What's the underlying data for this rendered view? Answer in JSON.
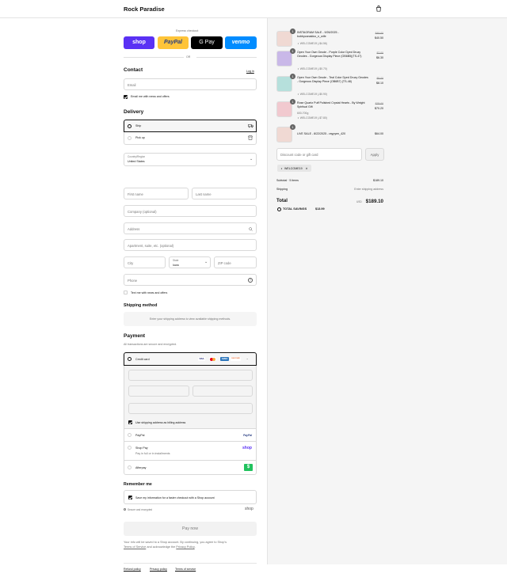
{
  "header": {
    "brand": "Rock Paradise",
    "bag_icon": "shopping-bag-icon"
  },
  "express": {
    "label": "Express checkout",
    "buttons": [
      {
        "label": "shop",
        "color": "#5a31f4"
      },
      {
        "label": "PayPal",
        "color": "#ffc439"
      },
      {
        "label": "G Pay",
        "color": "#000000"
      },
      {
        "label": "venmo",
        "color": "#008cff"
      }
    ],
    "or": "OR"
  },
  "contact": {
    "title": "Contact",
    "login": "Log in",
    "email_placeholder": "Email",
    "news_label": "Email me with news and offers",
    "news_checked": true
  },
  "delivery": {
    "title": "Delivery",
    "ship": "Ship",
    "pickup": "Pick up",
    "country_label": "Country/Region",
    "country_value": "United States",
    "first_name": "First name",
    "last_name": "Last name",
    "company": "Company (optional)",
    "address": "Address",
    "apartment": "Apartment, suite, etc. (optional)",
    "city": "City",
    "state_label": "State",
    "state_value": "Iowa",
    "zip": "ZIP code",
    "phone": "Phone",
    "text_news": "Text me with news and offers"
  },
  "shipping": {
    "title": "Shipping method",
    "note": "Enter your shipping address to view available shipping methods."
  },
  "payment": {
    "title": "Payment",
    "subtitle": "All transactions are secure and encrypted.",
    "credit_card": "Credit card",
    "card_logos": [
      "VISA",
      "MC",
      "AMEX",
      "DISCOVER",
      "+4"
    ],
    "billing_same": "Use shipping address as billing address",
    "paypal": "PayPal",
    "paypal_logo": "PayPal",
    "shoppay": "Shop Pay",
    "shoppay_sub": "Pay in full or in installments",
    "shoppay_logo": "shop",
    "afterpay": "Afterpay"
  },
  "remember": {
    "title": "Remember me",
    "label": "Save my information for a faster checkout with a Shop account",
    "secure": "Secure and encrypted",
    "shop_logo": "shop"
  },
  "pay_button": "Pay now",
  "legal": {
    "line1": "Your info will be saved to a Shop account. By continuing, you agree to Shop's",
    "terms": "Terms of Service",
    "and": "and acknowledge the",
    "privacy": "Privacy Policy",
    "end": "."
  },
  "footer": {
    "refund": "Refund policy",
    "privacy": "Privacy policy",
    "terms": "Terms of service"
  },
  "cart": {
    "items": [
      {
        "qty": "1",
        "title": "INSTAGRAM SALE - 9/26/2025 - bobbycanaldco_n_wife",
        "variant": "",
        "discount": "WELCOME19 (-$4.56)",
        "old_price": "$45.00",
        "price": "$40.50",
        "thumb_color": "#f0d9d3"
      },
      {
        "qty": "1",
        "title": "Open Your Own Geode - Purple Color Dyed Druzy Geodes - Gorgeous Display Piece (OB6B5)(TS-47)",
        "variant": "",
        "discount": "WELCOME19 (-$0.70)",
        "old_price": "$7.00",
        "price": "$6.30",
        "thumb_color": "#c9b8e8"
      },
      {
        "qty": "1",
        "title": "Open Your Own Geode - Teal Color Dyed Druzy Geodes - Gorgeous Display Piece (OB6B7) (TS-48)",
        "variant": "",
        "discount": "WELCOME19 (-$0.90)",
        "old_price": "$9.00",
        "price": "$8.10",
        "thumb_color": "#b6e0dc"
      },
      {
        "qty": "1",
        "title": "Rose Quartz Puff Polished Crystal Hearts - By Weight Spiritual Gift",
        "variant": "600-700g",
        "discount": "WELCOME19 (-$7.80)",
        "old_price": "$78.00",
        "price": "$70.20",
        "thumb_color": "#f1c9cf"
      },
      {
        "qty": "1",
        "title": "LIVE SALE - 8/22/2025 - raypyen_420",
        "variant": "",
        "discount": "",
        "old_price": "",
        "price": "$64.00",
        "thumb_color": "#f0d9d3"
      }
    ],
    "discount_placeholder": "Discount code or gift card",
    "apply": "Apply",
    "applied_code": "WELCOME19",
    "subtotal_label": "Subtotal · 5 items",
    "subtotal": "$189.10",
    "shipping_label": "Shipping",
    "shipping_value": "Enter shipping address",
    "total_label": "Total",
    "currency": "USD",
    "total": "$189.10",
    "savings_label": "TOTAL SAVINGS",
    "savings": "$13.99"
  }
}
